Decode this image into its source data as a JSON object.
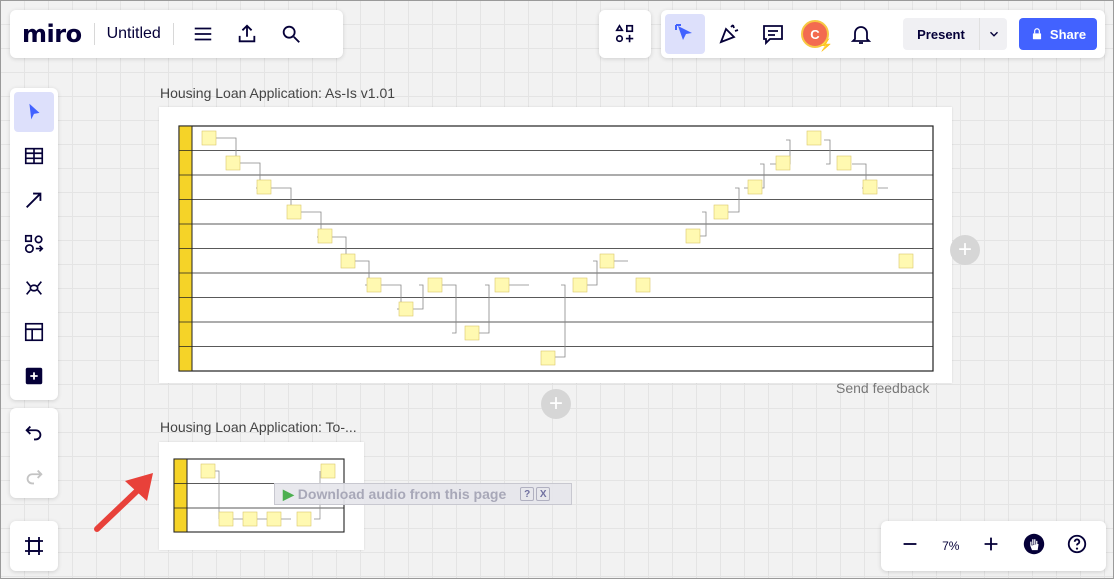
{
  "app": {
    "logo": "miro",
    "board_title": "Untitled"
  },
  "topbar": {
    "present_label": "Present",
    "share_label": "Share",
    "avatar_initial": "C"
  },
  "frames": [
    {
      "title": "Housing Loan Application: As-Is v1.01"
    },
    {
      "title": "Housing Loan Application: To-..."
    }
  ],
  "feedback_label": "Send feedback",
  "zoom": {
    "level": "7%"
  },
  "audio_bar": {
    "label": "Download audio from this page",
    "help": "?",
    "close": "X"
  },
  "colors": {
    "accent": "#4262ff",
    "sticky": "#fff9b1",
    "lane": "#f5d328",
    "arrow": "#e8413a"
  },
  "icons": {
    "top": [
      "menu-icon",
      "upload-icon",
      "search-icon"
    ],
    "apps": "apps-icon",
    "topright": [
      "cursor-select-icon",
      "celebration-icon",
      "comment-icon",
      "bell-icon"
    ],
    "tools": [
      "cursor-icon",
      "table-icon",
      "line-arrow-icon",
      "shapes-icon",
      "mind-map-icon",
      "template-icon",
      "add-more-icon"
    ]
  }
}
